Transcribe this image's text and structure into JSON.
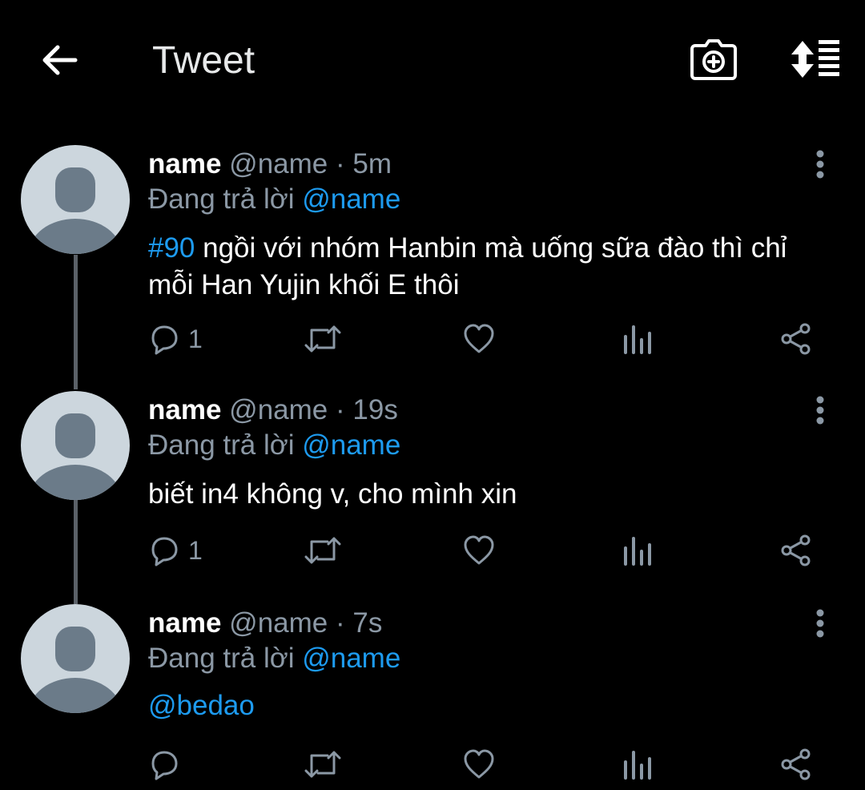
{
  "header": {
    "title": "Tweet"
  },
  "colors": {
    "accent": "#1d9bf0",
    "muted": "#8b98a5",
    "background": "#000000",
    "avatar_bg": "#ccd6dd",
    "avatar_fg": "#6b7b89"
  },
  "icons": {
    "back": "arrow-left-icon",
    "camera": "camera-plus-icon",
    "sort": "sort-icon",
    "more": "more-vertical-icon",
    "reply": "reply-icon",
    "retweet": "retweet-icon",
    "like": "heart-icon",
    "stats": "stats-icon",
    "share": "share-icon"
  },
  "tweets": [
    {
      "name": "name",
      "handle": "@name",
      "dot": "·",
      "time": "5m",
      "reply_prefix": "Đang trả lời",
      "reply_to": "@name",
      "text_link": "#90",
      "text": " ngồi với nhóm Hanbin mà uống sữa đào thì chỉ mỗi Han Yujin khối E thôi",
      "reply_count": "1"
    },
    {
      "name": "name",
      "handle": "@name",
      "dot": "·",
      "time": "19s",
      "reply_prefix": "Đang trả lời",
      "reply_to": "@name",
      "text_link": "",
      "text": "biết in4 không v, cho mình xin",
      "reply_count": "1"
    },
    {
      "name": "name",
      "handle": "@name",
      "dot": "·",
      "time": "7s",
      "reply_prefix": "Đang trả lời",
      "reply_to": "@name",
      "text_link": "@bedao",
      "text": "",
      "reply_count": ""
    }
  ]
}
